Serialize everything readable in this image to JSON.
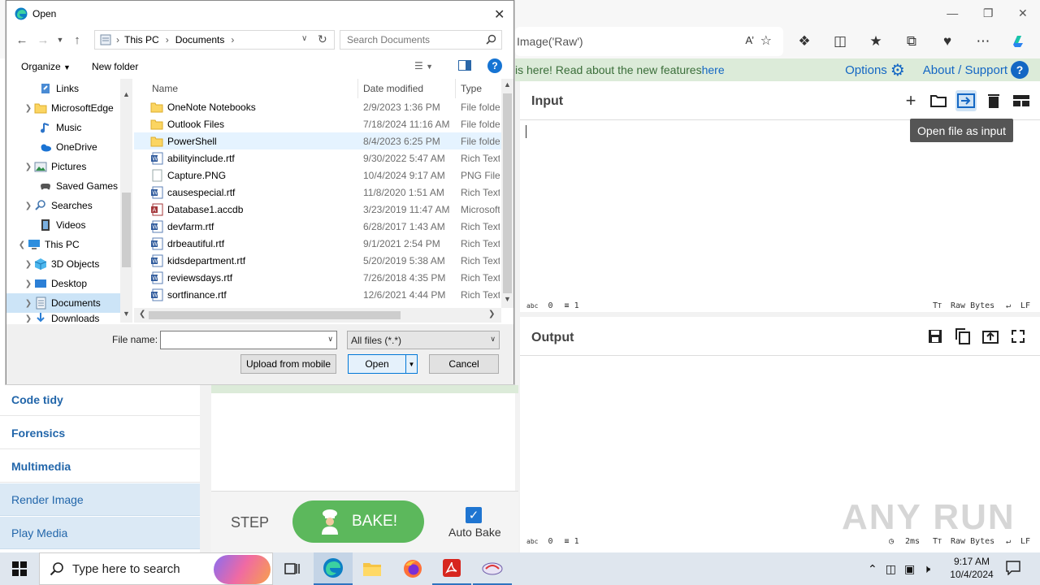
{
  "browser": {
    "address_text": "Image('Raw')",
    "banner_text": "is here! Read about the new features ",
    "banner_link": "here",
    "options_label": "Options",
    "about_label": "About / Support"
  },
  "input_panel": {
    "title": "Input",
    "tooltip": "Open file as input",
    "status_chars_icon": "abc",
    "status_chars": "0",
    "status_lines": "1",
    "status_encoding": "Raw Bytes",
    "status_eol": "LF"
  },
  "output_panel": {
    "title": "Output",
    "status_chars_icon": "abc",
    "status_chars": "0",
    "status_lines": "1",
    "status_time": "2ms",
    "status_encoding": "Raw Bytes",
    "status_eol": "LF"
  },
  "left_categories": [
    {
      "label": "Code tidy"
    },
    {
      "label": "Forensics"
    },
    {
      "label": "Multimedia"
    },
    {
      "label": "Render Image"
    },
    {
      "label": "Play Media"
    }
  ],
  "recipe_controls": {
    "step_label": "STEP",
    "bake_label": "BAKE!",
    "auto_bake_label": "Auto Bake",
    "auto_bake_checked": true
  },
  "dialog": {
    "title": "Open",
    "breadcrumb": [
      "This PC",
      "Documents"
    ],
    "search_placeholder": "Search Documents",
    "organize_label": "Organize",
    "new_folder_label": "New folder",
    "tree": [
      {
        "label": "Links",
        "icon": "links-icon",
        "expandable": false,
        "indent": 2
      },
      {
        "label": "MicrosoftEdge",
        "icon": "folder-icon",
        "expandable": true,
        "indent": 2
      },
      {
        "label": "Music",
        "icon": "music-icon",
        "expandable": false,
        "indent": 2
      },
      {
        "label": "OneDrive",
        "icon": "onedrive-icon",
        "expandable": false,
        "indent": 2
      },
      {
        "label": "Pictures",
        "icon": "pictures-icon",
        "expandable": true,
        "indent": 2
      },
      {
        "label": "Saved Games",
        "icon": "saved-games-icon",
        "expandable": false,
        "indent": 2
      },
      {
        "label": "Searches",
        "icon": "searches-icon",
        "expandable": true,
        "indent": 2
      },
      {
        "label": "Videos",
        "icon": "videos-icon",
        "expandable": false,
        "indent": 2
      },
      {
        "label": "This PC",
        "icon": "this-pc-icon",
        "expandable": true,
        "indent": 1,
        "expanded": true
      },
      {
        "label": "3D Objects",
        "icon": "3d-objects-icon",
        "expandable": true,
        "indent": 2
      },
      {
        "label": "Desktop",
        "icon": "desktop-icon",
        "expandable": true,
        "indent": 2
      },
      {
        "label": "Documents",
        "icon": "documents-icon",
        "expandable": true,
        "indent": 2,
        "selected": true
      },
      {
        "label": "Downloads",
        "icon": "downloads-icon",
        "expandable": true,
        "indent": 2
      }
    ],
    "columns": [
      "Name",
      "Date modified",
      "Type"
    ],
    "files": [
      {
        "name": "OneNote Notebooks",
        "date": "2/9/2023 1:36 PM",
        "type": "File folder",
        "icon": "folder-icon"
      },
      {
        "name": "Outlook Files",
        "date": "7/18/2024 11:16 AM",
        "type": "File folder",
        "icon": "folder-icon"
      },
      {
        "name": "PowerShell",
        "date": "8/4/2023 6:25 PM",
        "type": "File folder",
        "icon": "folder-icon",
        "selected": true
      },
      {
        "name": "abilityinclude.rtf",
        "date": "9/30/2022 5:47 AM",
        "type": "Rich Text",
        "icon": "word-doc-icon"
      },
      {
        "name": "Capture.PNG",
        "date": "10/4/2024 9:17 AM",
        "type": "PNG File",
        "icon": "image-file-icon"
      },
      {
        "name": "causespecial.rtf",
        "date": "11/8/2020 1:51 AM",
        "type": "Rich Text",
        "icon": "word-doc-icon"
      },
      {
        "name": "Database1.accdb",
        "date": "3/23/2019 11:47 AM",
        "type": "Microsoft",
        "icon": "access-db-icon"
      },
      {
        "name": "devfarm.rtf",
        "date": "6/28/2017 1:43 AM",
        "type": "Rich Text",
        "icon": "word-doc-icon"
      },
      {
        "name": "drbeautiful.rtf",
        "date": "9/1/2021 2:54 PM",
        "type": "Rich Text",
        "icon": "word-doc-icon"
      },
      {
        "name": "kidsdepartment.rtf",
        "date": "5/20/2019 5:38 AM",
        "type": "Rich Text",
        "icon": "word-doc-icon"
      },
      {
        "name": "reviewsdays.rtf",
        "date": "7/26/2018 4:35 PM",
        "type": "Rich Text",
        "icon": "word-doc-icon"
      },
      {
        "name": "sortfinance.rtf",
        "date": "12/6/2021 4:44 PM",
        "type": "Rich Text",
        "icon": "word-doc-icon"
      }
    ],
    "filename_label": "File name:",
    "filename_value": "",
    "filetype_value": "All files (*.*)",
    "upload_label": "Upload from mobile",
    "open_label": "Open",
    "cancel_label": "Cancel"
  },
  "taskbar": {
    "search_placeholder": "Type here to search",
    "time": "9:17 AM",
    "date": "10/4/2024"
  },
  "watermark": "ANY RUN"
}
